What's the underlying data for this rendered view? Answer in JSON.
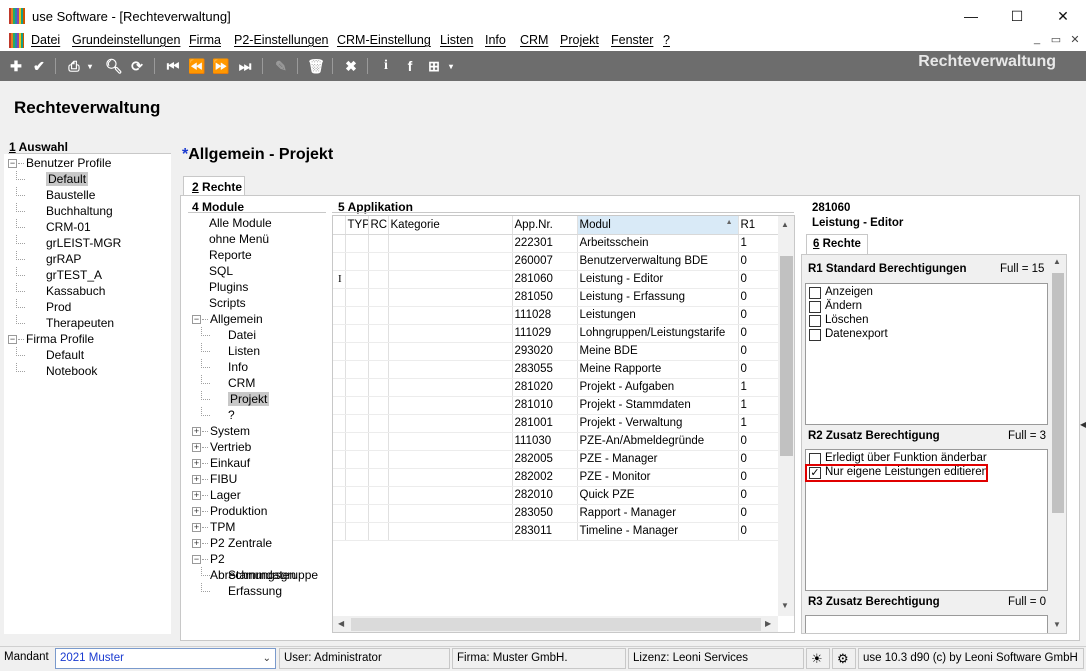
{
  "window": {
    "title": "use Software - [Rechteverwaltung]",
    "controls": {
      "minimize": "—",
      "maximize": "☐",
      "close": "✕"
    }
  },
  "menu": {
    "items": [
      "Datei",
      "Grundeinstellungen",
      "Firma",
      "P2-Einstellungen",
      "CRM-Einstellung",
      "Listen",
      "Info",
      "CRM",
      "Projekt",
      "Fenster",
      "?"
    ],
    "mdi_controls": [
      "_",
      "▭",
      "✕"
    ]
  },
  "toolbar": {
    "title": "Rechteverwaltung",
    "icons": [
      "add-icon",
      "check-icon",
      "print-icon",
      "search-icon",
      "refresh-icon",
      "first-record-icon",
      "previous-record-icon",
      "next-record-icon",
      "last-record-icon",
      "edit-icon",
      "delete-icon",
      "close-icon",
      "info-icon",
      "facebook-icon",
      "grid-icon"
    ]
  },
  "page_title": "Rechteverwaltung",
  "auswahl": {
    "number": "1",
    "label": "Auswahl",
    "tree": [
      {
        "label": "Benutzer Profile",
        "level": 0,
        "expander": "−"
      },
      {
        "label": "Default",
        "level": 1,
        "selected": true
      },
      {
        "label": "Baustelle",
        "level": 1
      },
      {
        "label": "Buchhaltung",
        "level": 1
      },
      {
        "label": "CRM-01",
        "level": 1
      },
      {
        "label": "grLEIST-MGR",
        "level": 1
      },
      {
        "label": "grRAP",
        "level": 1
      },
      {
        "label": "grTEST_A",
        "level": 1
      },
      {
        "label": "Kassabuch",
        "level": 1
      },
      {
        "label": "Prod",
        "level": 1
      },
      {
        "label": "Therapeuten",
        "level": 1
      },
      {
        "label": "Firma Profile",
        "level": 0,
        "expander": "−"
      },
      {
        "label": "Default",
        "level": 1
      },
      {
        "label": "Notebook",
        "level": 1
      }
    ]
  },
  "detail_title": {
    "marker": "*",
    "text": "Allgemein - Projekt"
  },
  "tab_rechte": {
    "number": "2",
    "label": "Rechte"
  },
  "module": {
    "number": "4",
    "label": "Module",
    "tree": [
      {
        "label": "Alle Module",
        "level": 0
      },
      {
        "label": "ohne Menü",
        "level": 0
      },
      {
        "label": "Reporte",
        "level": 0
      },
      {
        "label": "SQL",
        "level": 0
      },
      {
        "label": "Plugins",
        "level": 0
      },
      {
        "label": "Scripts",
        "level": 0
      },
      {
        "label": "Allgemein",
        "level": 0,
        "expander": "−"
      },
      {
        "label": "Datei",
        "level": 1
      },
      {
        "label": "Listen",
        "level": 1
      },
      {
        "label": "Info",
        "level": 1
      },
      {
        "label": "CRM",
        "level": 1
      },
      {
        "label": "Projekt",
        "level": 1,
        "selected": true
      },
      {
        "label": "?",
        "level": 1
      },
      {
        "label": "System",
        "level": 0,
        "expander": "+"
      },
      {
        "label": "Vertrieb",
        "level": 0,
        "expander": "+"
      },
      {
        "label": "Einkauf",
        "level": 0,
        "expander": "+"
      },
      {
        "label": "FIBU",
        "level": 0,
        "expander": "+"
      },
      {
        "label": "Lager",
        "level": 0,
        "expander": "+"
      },
      {
        "label": "Produktion",
        "level": 0,
        "expander": "+"
      },
      {
        "label": "TPM",
        "level": 0,
        "expander": "+"
      },
      {
        "label": "P2 Zentrale",
        "level": 0,
        "expander": "+"
      },
      {
        "label": "P2 Abrechnungsgruppe",
        "level": 0,
        "expander": "−"
      },
      {
        "label": "Stammdaten",
        "level": 1
      },
      {
        "label": "Erfassung",
        "level": 1
      }
    ]
  },
  "applikation": {
    "number": "5",
    "label": "Applikation",
    "columns": [
      "",
      "TYP",
      "RC",
      "Kategorie",
      "App.Nr.",
      "Modul",
      "R1"
    ],
    "sort_indicator": "▲",
    "rows": [
      [
        "222301",
        "Arbeitsschein",
        "1"
      ],
      [
        "260007",
        "Benutzerverwaltung BDE",
        "0"
      ],
      [
        "281060",
        "Leistung - Editor",
        "0"
      ],
      [
        "281050",
        "Leistung - Erfassung",
        "0"
      ],
      [
        "111028",
        "Leistungen",
        "0"
      ],
      [
        "111029",
        "Lohngruppen/Leistungstarife",
        "0"
      ],
      [
        "293020",
        "Meine BDE",
        "0"
      ],
      [
        "283055",
        "Meine Rapporte",
        "0"
      ],
      [
        "281020",
        "Projekt - Aufgaben",
        "1"
      ],
      [
        "281010",
        "Projekt - Stammdaten",
        "1"
      ],
      [
        "281001",
        "Projekt - Verwaltung",
        "1"
      ],
      [
        "111030",
        "PZE-An/Abmeldegründe",
        "0"
      ],
      [
        "282005",
        "PZE - Manager",
        "0"
      ],
      [
        "282002",
        "PZE - Monitor",
        "0"
      ],
      [
        "282010",
        "Quick PZE",
        "0"
      ],
      [
        "283050",
        "Rapport - Manager",
        "0"
      ],
      [
        "283011",
        "Timeline - Manager",
        "0"
      ]
    ]
  },
  "right_panel": {
    "app_nr": "281060",
    "app_name": "Leistung - Editor",
    "tab_number": "6",
    "tab_label": "Rechte",
    "r1": {
      "title": "R1 Standard Berechtigungen",
      "full": "Full = 15",
      "items": [
        {
          "label": "Anzeigen",
          "checked": false
        },
        {
          "label": "Ändern",
          "checked": false
        },
        {
          "label": "Löschen",
          "checked": false
        },
        {
          "label": "Datenexport",
          "checked": false
        }
      ]
    },
    "r2": {
      "title": "R2 Zusatz Berechtigung",
      "full": "Full = 3",
      "items": [
        {
          "label": "Erledigt über Funktion änderbar",
          "checked": false
        },
        {
          "label": "Nur eigene Leistungen editieren",
          "checked": true,
          "highlighted": true
        }
      ]
    },
    "r3": {
      "title": "R3 Zusatz Berechtigung",
      "full": "Full = 0"
    }
  },
  "statusbar": {
    "mandant_label": "Mandant",
    "mandant_value": "2021 Muster",
    "user": "User: Administrator",
    "firma": "Firma: Muster GmbH.",
    "lizenz": "Lizenz: Leoni Services",
    "version": "use 10.3 d90 (c) by Leoni Software GmbH"
  },
  "colors": {
    "toolbar_bg": "#6d6d6d",
    "highlight_border": "#e00000",
    "selection": "#c8c8c8",
    "sorted_header": "#d9eaf7",
    "title_marker": "#1a3ad0"
  }
}
